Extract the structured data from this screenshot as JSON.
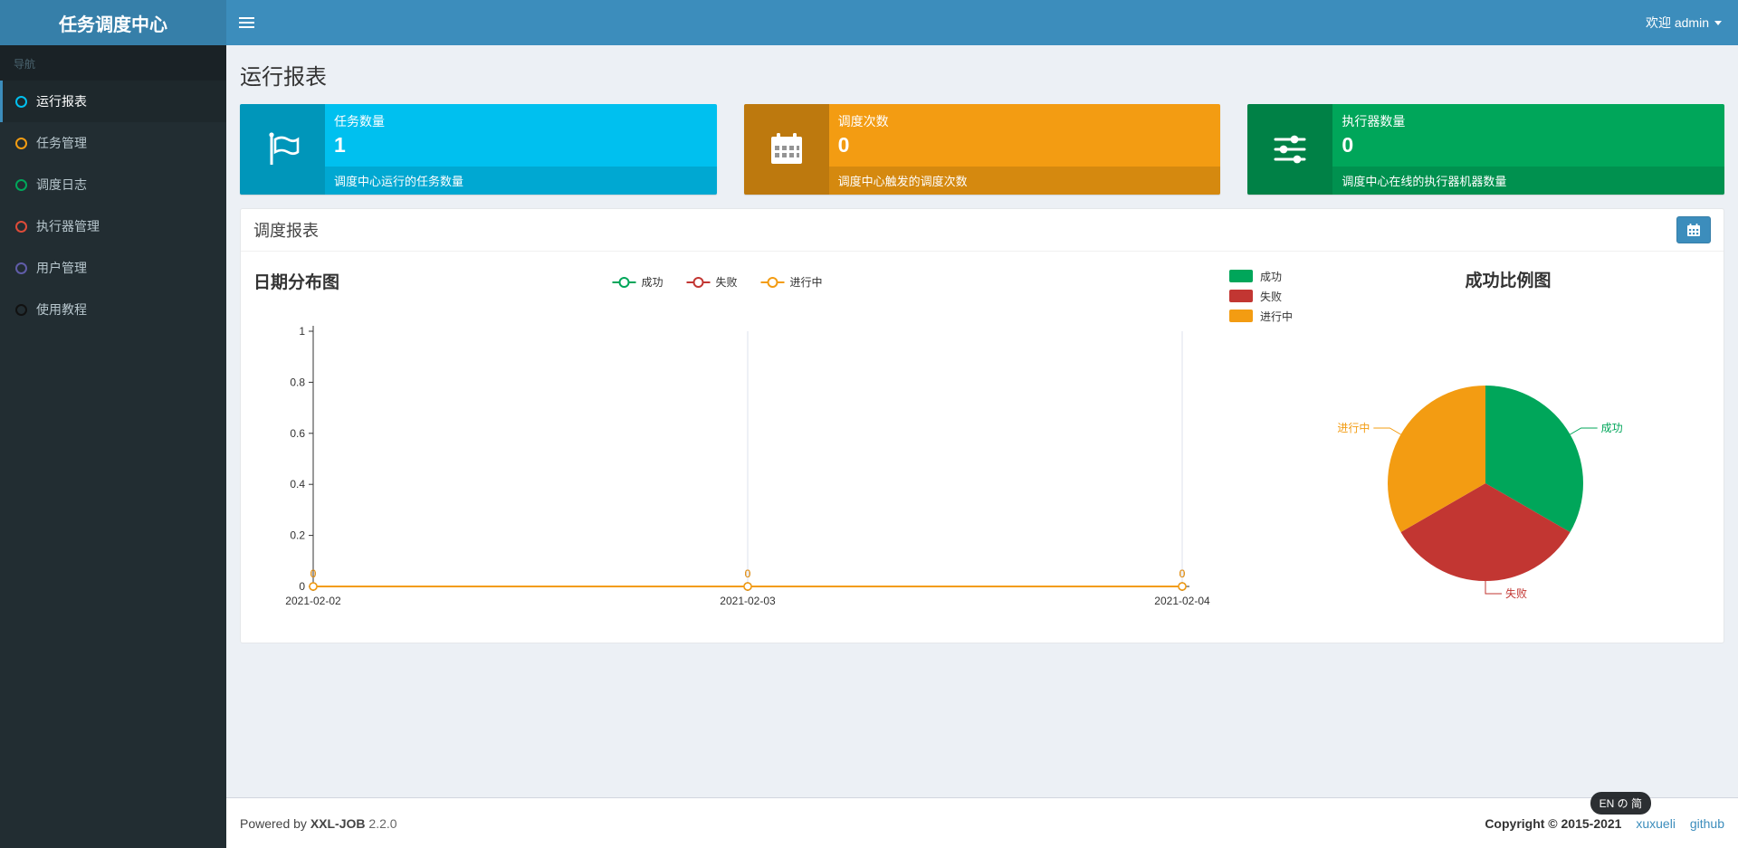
{
  "header": {
    "logo_title": "任务调度中心",
    "welcome_text": "欢迎 admin"
  },
  "sidebar": {
    "nav_label": "导航",
    "items": [
      {
        "label": "运行报表",
        "active": true,
        "icon_color": "#00c0ef"
      },
      {
        "label": "任务管理",
        "active": false,
        "icon_color": "#f39c12"
      },
      {
        "label": "调度日志",
        "active": false,
        "icon_color": "#00a65a"
      },
      {
        "label": "执行器管理",
        "active": false,
        "icon_color": "#dd4b39"
      },
      {
        "label": "用户管理",
        "active": false,
        "icon_color": "#605ca8"
      },
      {
        "label": "使用教程",
        "active": false,
        "icon_color": "#111111"
      }
    ]
  },
  "page_title": "运行报表",
  "info_boxes": [
    {
      "icon": "flag-icon",
      "color": "#00c0ef",
      "label": "任务数量",
      "value": "1",
      "desc": "调度中心运行的任务数量"
    },
    {
      "icon": "calendar-icon",
      "color": "#f39c12",
      "label": "调度次数",
      "value": "0",
      "desc": "调度中心触发的调度次数"
    },
    {
      "icon": "sliders-icon",
      "color": "#00a65a",
      "label": "执行器数量",
      "value": "0",
      "desc": "调度中心在线的执行器机器数量"
    }
  ],
  "panel": {
    "title": "调度报表"
  },
  "chart_data": [
    {
      "type": "line",
      "title": "日期分布图",
      "x": [
        "2021-02-02",
        "2021-02-03",
        "2021-02-04"
      ],
      "series": [
        {
          "name": "成功",
          "color": "#00A65A",
          "values": [
            0,
            0,
            0
          ]
        },
        {
          "name": "失败",
          "color": "#c23632",
          "values": [
            0,
            0,
            0
          ]
        },
        {
          "name": "进行中",
          "color": "#F39C12",
          "values": [
            0,
            0,
            0
          ]
        }
      ],
      "ylim": [
        0,
        1
      ],
      "yticks": [
        0,
        0.2,
        0.4,
        0.6,
        0.8,
        1
      ],
      "legend_position": "top-center",
      "grid": "vertical-splitlines"
    },
    {
      "type": "pie",
      "title": "成功比例图",
      "slices": [
        {
          "name": "成功",
          "value": 1,
          "color": "#00A65A"
        },
        {
          "name": "失败",
          "value": 1,
          "color": "#c23632"
        },
        {
          "name": "进行中",
          "value": 1,
          "color": "#F39C12"
        }
      ],
      "legend_position": "top-left"
    }
  ],
  "footer": {
    "powered_by": "Powered by",
    "brand": "XXL-JOB",
    "version": "2.2.0",
    "copyright": "Copyright © 2015-2021",
    "links": [
      {
        "label": "xuxueli"
      },
      {
        "label": "github"
      }
    ]
  },
  "lang_badge": "EN の 简"
}
